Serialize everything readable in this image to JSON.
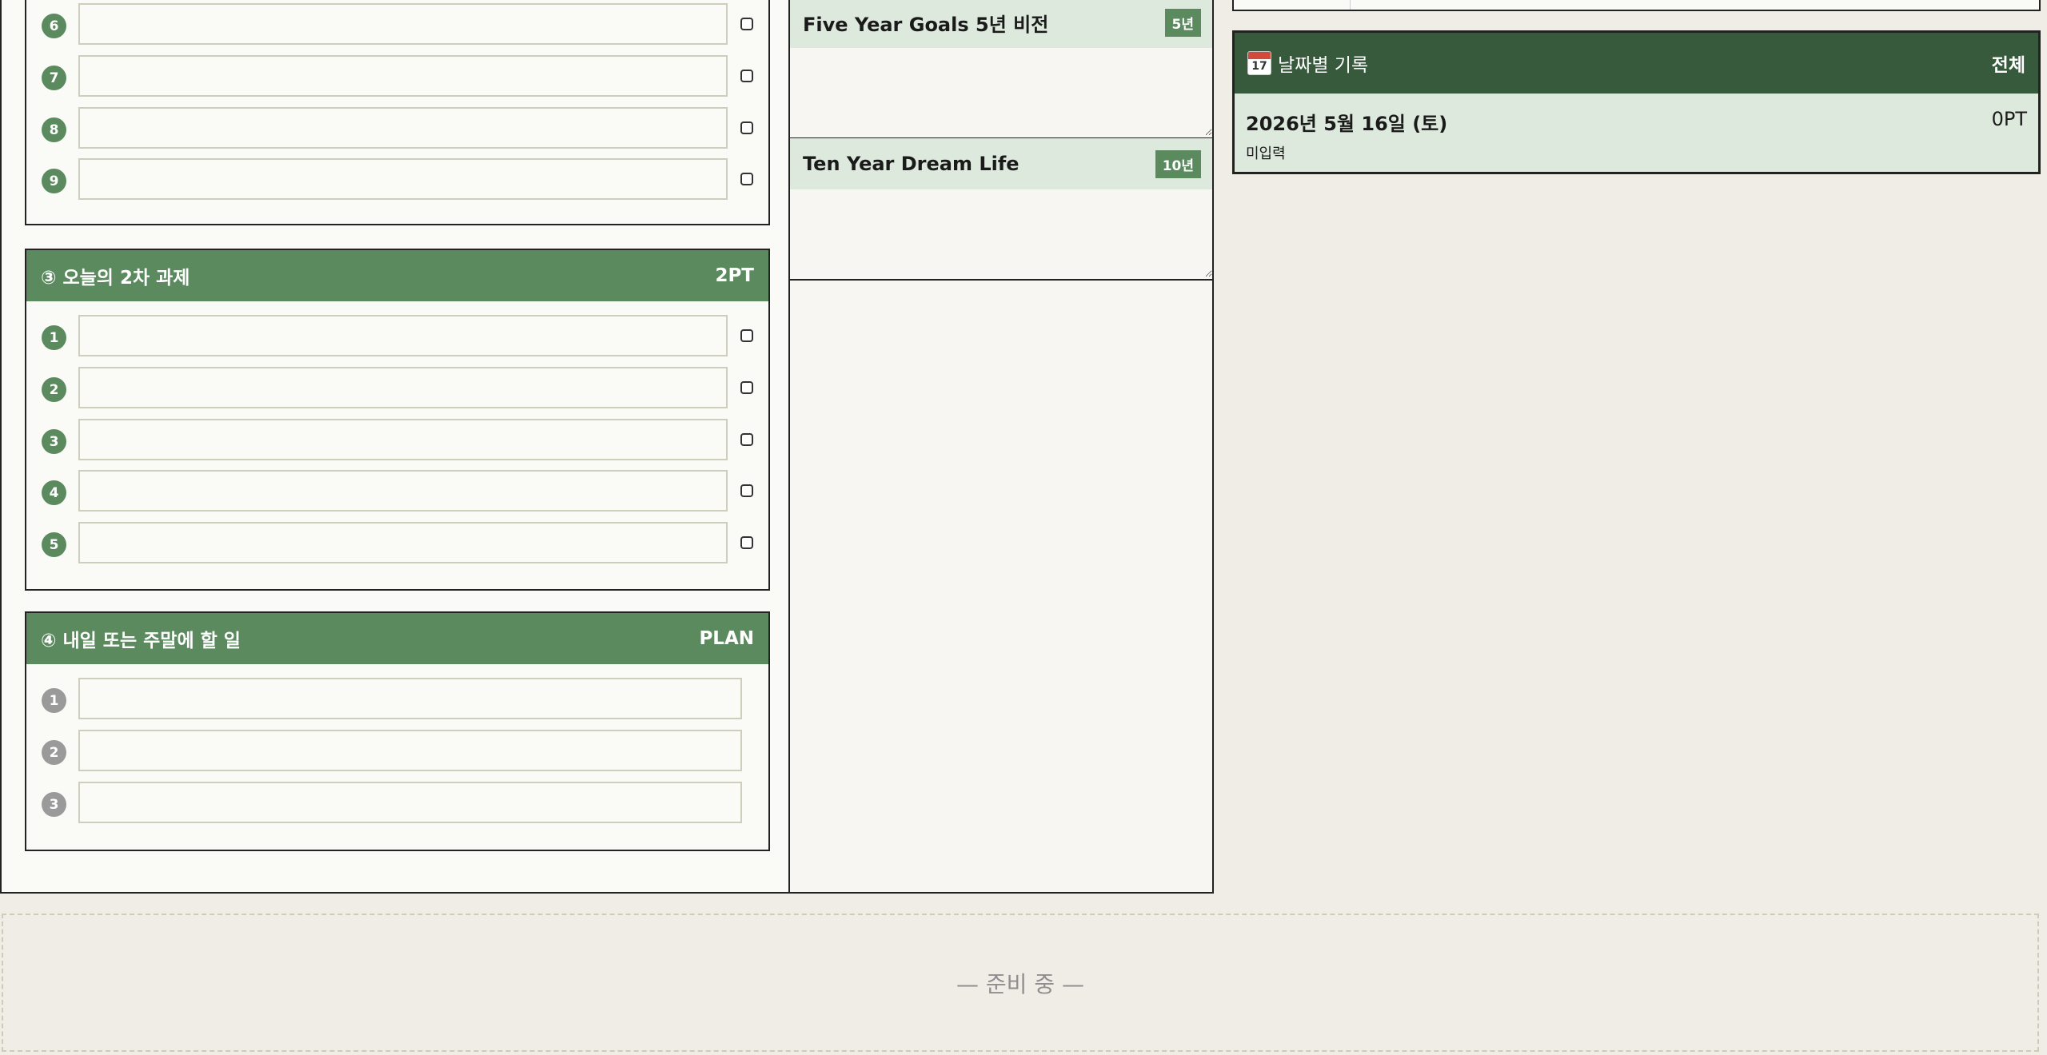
{
  "section_top": {
    "rows": [
      {
        "num": "6"
      },
      {
        "num": "7"
      },
      {
        "num": "8"
      },
      {
        "num": "9"
      }
    ]
  },
  "section_second": {
    "title": "③ 오늘의 2차 과제",
    "points": "2PT",
    "rows": [
      {
        "num": "1"
      },
      {
        "num": "2"
      },
      {
        "num": "3"
      },
      {
        "num": "4"
      },
      {
        "num": "5"
      }
    ]
  },
  "section_plan": {
    "title": "④ 내일 또는 주말에 할 일",
    "badge": "PLAN",
    "rows": [
      {
        "num": "1"
      },
      {
        "num": "2"
      },
      {
        "num": "3"
      }
    ]
  },
  "vision": {
    "five": {
      "title": "Five Year Goals 5년 비전",
      "badge": "5년"
    },
    "ten": {
      "title": "Ten Year Dream Life",
      "badge": "10년"
    }
  },
  "log": {
    "calendar_day": "17",
    "title": "날짜별 기록",
    "all_label": "전체",
    "entry": {
      "date": "2026년 5월 16일 (토)",
      "points": "0PT",
      "status": "미입력"
    }
  },
  "placeholder": {
    "text": "— 준비 중 —"
  },
  "colors": {
    "accent_green": "#5b8a5f",
    "dark_green": "#385a3c",
    "light_green": "#dde9dd",
    "background": "#f0ede6"
  }
}
